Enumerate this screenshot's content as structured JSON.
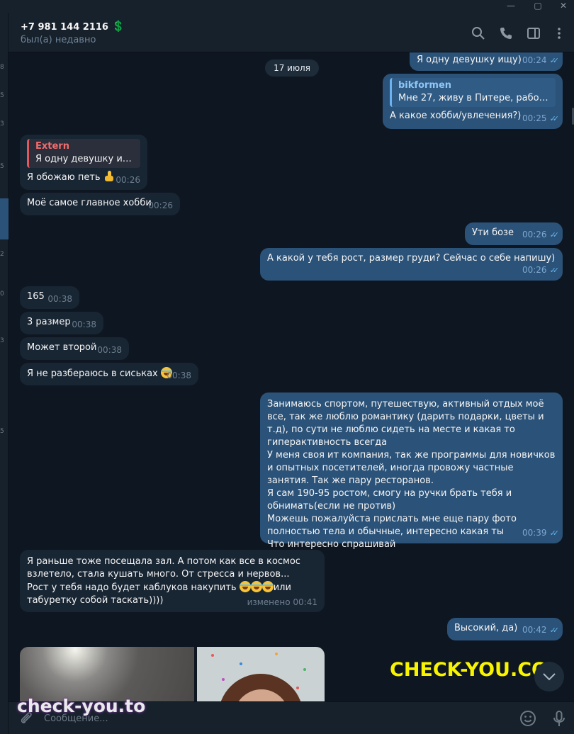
{
  "window": {
    "minimize": "—",
    "maximize": "▢",
    "close": "✕"
  },
  "header": {
    "peer_name": "+7 981 144 2116",
    "peer_emoji": "💲",
    "peer_status": "был(а) недавно",
    "icons": [
      "search-icon",
      "phone-icon",
      "sidebar-toggle-icon",
      "more-icon"
    ]
  },
  "left_strip": [
    "8",
    "5",
    "3",
    "5",
    "2",
    "0",
    "3",
    "5"
  ],
  "date_separator": "17 июля",
  "messages": [
    {
      "dir": "out",
      "text": "Я одну девушку ищу)",
      "time": "00:24"
    },
    {
      "dir": "out",
      "reply_author": "bikformen",
      "reply_text": "Мне 27, живу в Питере, работаю ...",
      "text": "А какое хобби/увлечения?)",
      "time": "00:25"
    },
    {
      "dir": "in",
      "reply_author": "Extern",
      "reply_text": "Я одну девушку ищу)",
      "text": "Я обожаю петь",
      "emoji": "thumbs-up",
      "time": "00:26"
    },
    {
      "dir": "in",
      "text": "Моё самое главное хобби",
      "time": "00:26"
    },
    {
      "dir": "out",
      "text": "Ути бозе",
      "time": "00:26"
    },
    {
      "dir": "out",
      "text": "А какой у тебя рост, размер груди? Сейчас о себе напишу)",
      "time": "00:26"
    },
    {
      "dir": "in",
      "text": "165",
      "time": "00:38"
    },
    {
      "dir": "in",
      "text": "3 размер",
      "time": "00:38"
    },
    {
      "dir": "in",
      "text": "Может второй",
      "time": "00:38"
    },
    {
      "dir": "in",
      "text": "Я не разбераюсь в сиськах",
      "emoji": "laughing",
      "time": "00:38"
    },
    {
      "dir": "out",
      "text": "Занимаюсь спортом, путешествую, активный отдых моё все, так же люблю романтику (дарить подарки, цветы и т.д), по сути не люблю сидеть на месте и какая то гиперактивность всегда\nУ меня своя ит компания, так же программы для новичков и опытных посетителей, иногда провожу частные занятия. Так же пару ресторанов.\nЯ сам 190-95 ростом, смогу на ручки брать тебя и обнимать(если не против)\nМожешь пожалуйста прислать мне еще пару фото полностью тела и обычные, интересно какая ты\nЧто интересно спрашивай",
      "time": "00:39"
    },
    {
      "dir": "in",
      "text_a": "Я раньше тоже посещала зал. А потом как все в космос взлетело, стала кушать много. От стресса и нервов...\nРост у тебя надо будет каблуков накупить ",
      "text_b": "или\nтабуретку собой таскать))))",
      "time": "изменено 00:41"
    },
    {
      "dir": "out",
      "text": "Высокий, да)",
      "time": "00:42"
    }
  ],
  "input": {
    "placeholder": "Сообщение..."
  },
  "watermarks": {
    "top": "CHECK-YOU.CO",
    "bottom": "check-you.to"
  },
  "colors": {
    "bg": "#0e1621",
    "panel": "#17212b",
    "out_bubble": "#2b5278",
    "in_bubble": "#182533",
    "accent": "#64b5ef",
    "watermark_yellow": "#f8f400"
  }
}
